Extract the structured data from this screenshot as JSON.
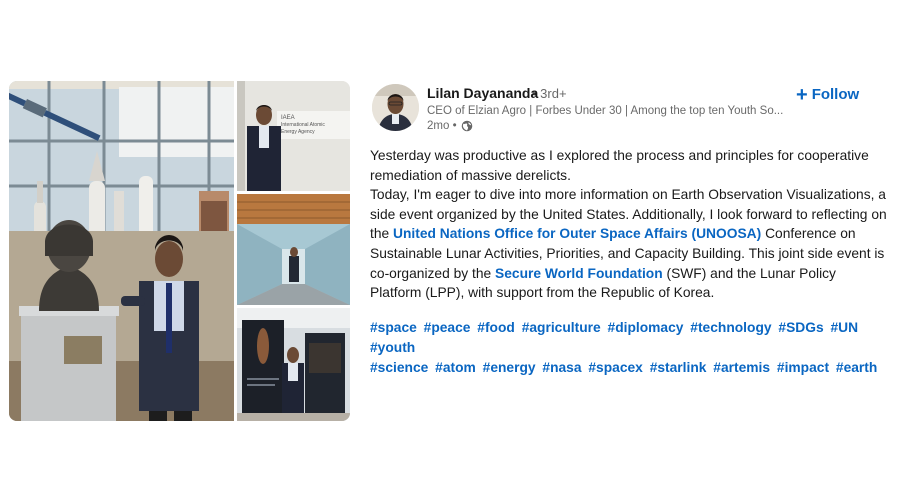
{
  "photos": [
    {
      "label": "main-photo-bust-exhibit"
    },
    {
      "label": "photo-iaea-entrance"
    },
    {
      "label": "photo-glass-corridor"
    },
    {
      "label": "photo-exhibit-panels"
    }
  ],
  "iaea_sign_text": "IAEA\nInternational Atomic\nEnergy Agency",
  "author": {
    "name": "Lilan Dayananda",
    "degree": "• 3rd+",
    "headline": "CEO of Elzian Agro | Forbes Under 30 | Among the top ten Youth So...",
    "time": "2mo •",
    "visibility_icon": "globe-icon"
  },
  "follow": {
    "icon": "plus-icon",
    "label": "Follow"
  },
  "body": {
    "p1": "Yesterday was productive as I explored the process and principles for cooperative remediation of massive derelicts.",
    "p2_a": "Today, I'm eager to dive into more information on Earth Observation Visualizations, a side event organized by the United States. Additionally, I look forward to reflecting on the ",
    "p2_link1": "United Nations Office for Outer Space Affairs (UNOOSA)",
    "p2_b": " Conference on Sustainable Lunar Activities, Priorities, and Capacity Building. This joint side event is co-organized by the ",
    "p2_link2": "Secure World Foundation",
    "p2_c": " (SWF) and the Lunar Policy Platform (LPP), with support from the Republic of Korea."
  },
  "hashtags": [
    "#space",
    "#peace",
    "#food",
    "#agriculture",
    "#diplomacy",
    "#technology",
    "#SDGs",
    "#UN",
    "#youth",
    "#science",
    "#atom",
    "#energy",
    "#nasa",
    "#spacex",
    "#starlink",
    "#artemis",
    "#impact",
    "#earth"
  ],
  "colors": {
    "link": "#0a66c2",
    "text": "#191919",
    "muted": "#666666"
  }
}
